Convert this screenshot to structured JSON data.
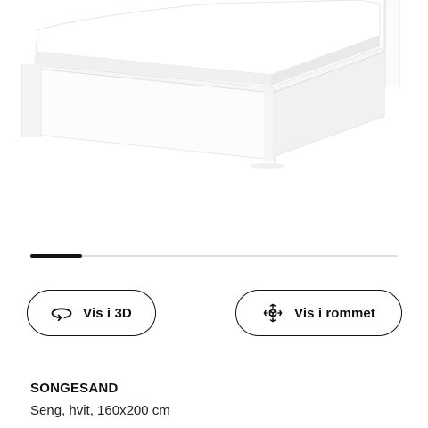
{
  "carousel": {
    "image_alt": "SONGESAND seng, hvit",
    "progress_fraction": 0.14
  },
  "actions": {
    "view_3d_label": "Vis i 3D",
    "view_3d_icon": "rotate-360-icon",
    "view_in_room_label": "Vis i rommet",
    "view_in_room_icon": "augmented-reality-icon"
  },
  "product": {
    "name": "SONGESAND",
    "description": "Seng, hvit, 160x200 cm"
  },
  "colors": {
    "accent": "#111111",
    "track": "#dfdfdf",
    "background": "#ffffff"
  }
}
